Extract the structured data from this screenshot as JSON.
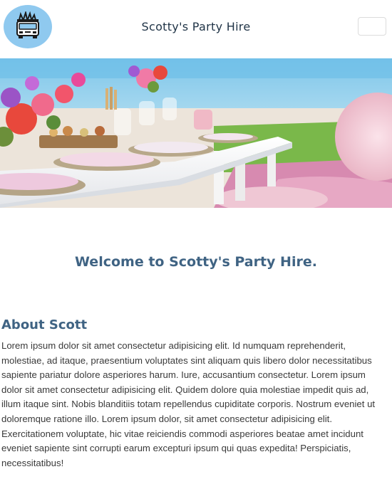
{
  "header": {
    "logo_icon": "food-truck-logo-icon",
    "title": "Scotty's Party Hire",
    "menu_icon": "menu-toggle-button"
  },
  "hero": {
    "image": "picnic-party-table-setup-on-beach"
  },
  "main": {
    "welcome": "Welcome to Scotty's Party Hire.",
    "about_heading": "About Scott",
    "about_text": "Lorem ipsum dolor sit amet consectetur adipisicing elit. Id numquam reprehenderit, molestiae, ad itaque, praesentium voluptates sint aliquam quis libero dolor necessitatibus sapiente pariatur dolore asperiores harum. Iure, accusantium consectetur. Lorem ipsum dolor sit amet consectetur adipisicing elit. Quidem dolore quia molestiae impedit quis ad, illum itaque sint. Nobis blanditiis totam repellendus cupiditate corporis. Nostrum eveniet ut doloremque ratione illo. Lorem ipsum dolor, sit amet consectetur adipisicing elit. Exercitationem voluptate, hic vitae reiciendis commodi asperiores beatae amet incidunt eveniet sapiente sint corrupti earum excepturi ipsum qui quas expedita! Perspiciatis, necessitatibus!"
  },
  "colors": {
    "heading": "#3f6383",
    "title": "#1f3346",
    "logo_bg": "#8fc9ef"
  }
}
